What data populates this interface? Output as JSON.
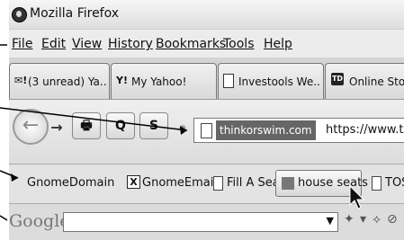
{
  "window": {
    "title": "Mozilla Firefox"
  },
  "menubar": {
    "items": [
      "File",
      "Edit",
      "View",
      "History",
      "Bookmarks",
      "Tools",
      "Help"
    ]
  },
  "tabs": [
    {
      "icon": "yahoo-mail-icon",
      "icon_text": "✉!",
      "label": "(3 unread) Ya..."
    },
    {
      "icon": "yahoo-icon",
      "icon_text": "Y!",
      "label": "My Yahoo!"
    },
    {
      "icon": "document-icon",
      "label": "Investools We..."
    },
    {
      "icon": "td-icon",
      "icon_text": "TD",
      "label": "Online Stoc"
    }
  ],
  "navbar": {
    "back_icon": "←",
    "forward_icon": "→",
    "print_icon": "🖶",
    "search_icon": "Q",
    "stop_icon": "S",
    "site_identity": "thinkorswim.com",
    "url": "https://www.think"
  },
  "bookmarks": {
    "items": [
      "GnomeDomain",
      "GnomeEmail",
      "Fill A Seat",
      "house seats",
      "TOS"
    ]
  },
  "google_toolbar": {
    "logo": "Google",
    "dropdown_arrow": "▼",
    "tool_icons": [
      "✦",
      "▾",
      "⟡",
      "⊘"
    ]
  }
}
